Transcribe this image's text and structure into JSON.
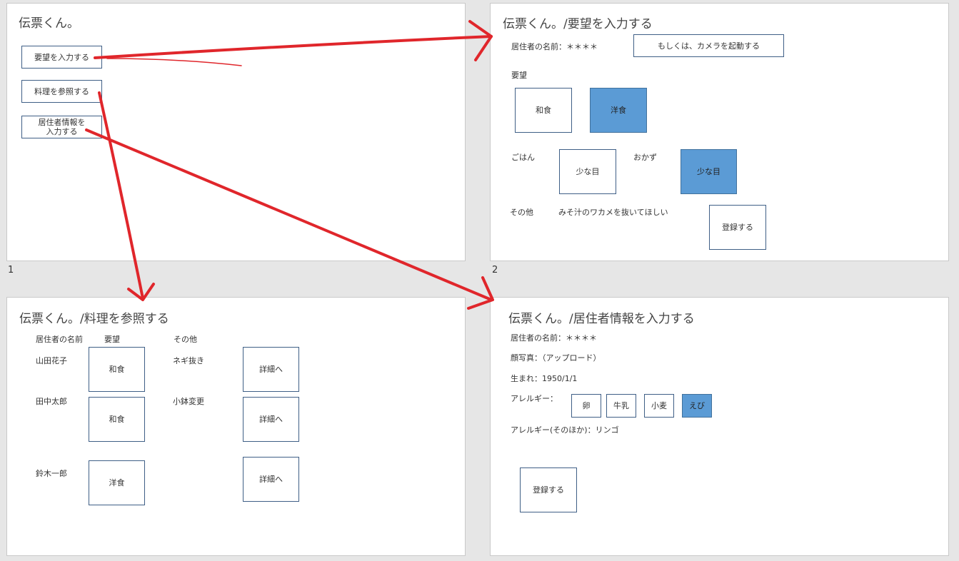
{
  "slides": [
    {
      "number": "1",
      "title": "伝票くん。",
      "buttons": [
        "要望を入力する",
        "料理を参照する",
        "居住者情報を\n入力する"
      ]
    },
    {
      "number": "2",
      "title": "伝票くん。/要望を入力する",
      "resident_label": "居住者の名前：＊＊＊＊",
      "camera_button": "もしくは、カメラを起動する",
      "request_label": "要望",
      "meal_options": [
        {
          "label": "和食",
          "selected": false
        },
        {
          "label": "洋食",
          "selected": true
        }
      ],
      "rice_label": "ごはん",
      "rice_option": "少な目",
      "side_label": "おかず",
      "side_option": "少な目",
      "other_label": "その他",
      "other_value": "みそ汁のワカメを抜いてほしい",
      "register_button": "登録する"
    },
    {
      "title": "伝票くん。/料理を参照する",
      "headers": [
        "居住者の名前",
        "要望",
        "その他"
      ],
      "rows": [
        {
          "name": "山田花子",
          "request": "和食",
          "other": "ネギ抜き",
          "detail": "詳細へ"
        },
        {
          "name": "田中太郎",
          "request": "和食",
          "other": "小鉢変更",
          "detail": "詳細へ"
        },
        {
          "name": "鈴木一郎",
          "request": "洋食",
          "other": "",
          "detail": "詳細へ"
        }
      ]
    },
    {
      "title": "伝票くん。/居住者情報を入力する",
      "resident_label": "居住者の名前：＊＊＊＊",
      "photo_label": "顔写真：（アップロード）",
      "birth_label": "生まれ：1950/1/1",
      "allergy_label": "アレルギー：",
      "allergies": [
        {
          "label": "卵",
          "selected": false
        },
        {
          "label": "牛乳",
          "selected": false
        },
        {
          "label": "小麦",
          "selected": false
        },
        {
          "label": "えび",
          "selected": true
        }
      ],
      "allergy_other_label": "アレルギー(そのほか)：リンゴ",
      "register_button": "登録する"
    }
  ],
  "colors": {
    "arrow": "#e0262b",
    "selected": "#5b9bd5",
    "border": "#3f5f86"
  }
}
